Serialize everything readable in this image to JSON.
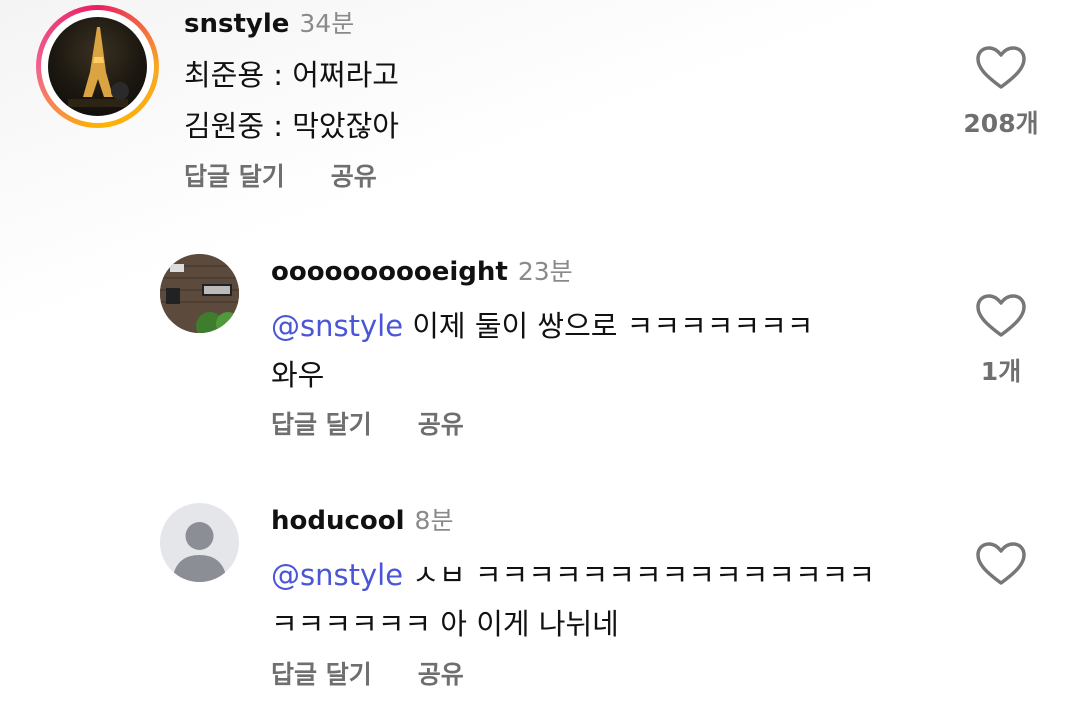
{
  "comments": [
    {
      "username": "snstyle",
      "time": "34분",
      "lines": [
        "최준용 : 어쩌라고",
        "김원중 : 막았잖아"
      ],
      "actions": {
        "reply": "답글 달기",
        "share": "공유"
      },
      "likes": "208개"
    },
    {
      "username": "oooooooooeight",
      "time": "23분",
      "mention": "@snstyle",
      "lines": [
        " 이제 둘이 쌍으로 ㅋㅋㅋㅋㅋㅋㅋ",
        "와우"
      ],
      "actions": {
        "reply": "답글 달기",
        "share": "공유"
      },
      "likes": "1개"
    },
    {
      "username": "hoducool",
      "time": "8분",
      "mention": "@snstyle",
      "lines": [
        " ㅅㅂ ㅋㅋㅋㅋㅋㅋㅋㅋㅋㅋㅋㅋㅋㅋㅋ",
        "ㅋㅋㅋㅋㅋㅋ 아 이게 나뉘네"
      ],
      "actions": {
        "reply": "답글 달기",
        "share": "공유"
      },
      "likes": ""
    }
  ],
  "icons": {
    "like": "heart-icon",
    "avatar_placeholder": "default-user-icon"
  },
  "colors": {
    "mention": "#4a56d6",
    "muted": "#6f6f6f",
    "story_ring_start": "#f9a825",
    "story_ring_end": "#e91e63"
  }
}
